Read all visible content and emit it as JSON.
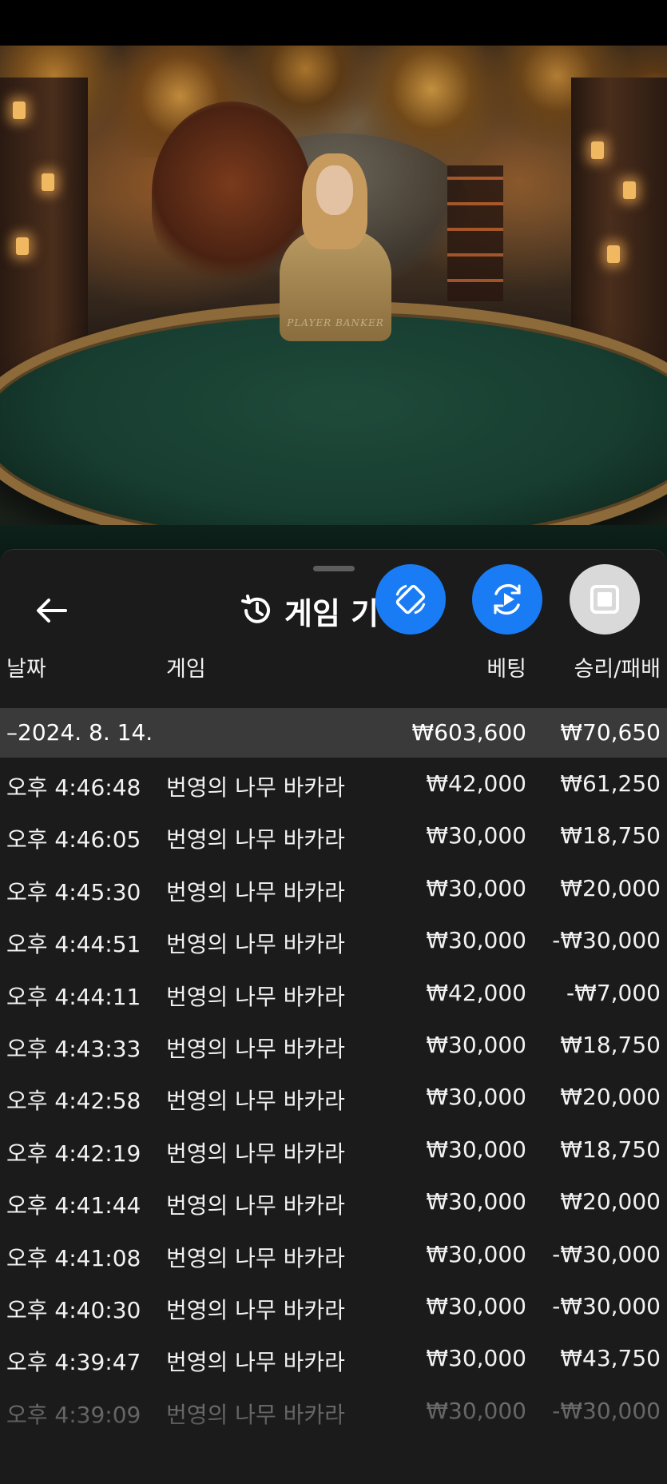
{
  "video": {
    "table_label": "PLAYER    BANKER"
  },
  "sheet": {
    "title": "게임 기",
    "icons": {
      "back": "arrow-left-icon",
      "history": "history-clock-icon",
      "rotate": "rotate-screen-icon",
      "replay": "replay-play-icon",
      "stop": "stop-square-icon"
    },
    "colors": {
      "sheet_bg": "#1b1b1b",
      "date_group_bg": "#3a3a3a",
      "fab_blue": "#1a7cf5",
      "fab_grey": "#d9d9d9"
    }
  },
  "table": {
    "headers": {
      "date": "날짜",
      "game": "게임",
      "bet": "베팅",
      "result": "승리/패배"
    },
    "group": {
      "date": "–2024. 8. 14.",
      "bet_total": "₩603,600",
      "result_total": "₩70,650"
    },
    "rows": [
      {
        "time": "오후 4:46:48",
        "game": "번영의 나무 바카라",
        "bet": "₩42,000",
        "result": "₩61,250"
      },
      {
        "time": "오후 4:46:05",
        "game": "번영의 나무 바카라",
        "bet": "₩30,000",
        "result": "₩18,750"
      },
      {
        "time": "오후 4:45:30",
        "game": "번영의 나무 바카라",
        "bet": "₩30,000",
        "result": "₩20,000"
      },
      {
        "time": "오후 4:44:51",
        "game": "번영의 나무 바카라",
        "bet": "₩30,000",
        "result": "-₩30,000"
      },
      {
        "time": "오후 4:44:11",
        "game": "번영의 나무 바카라",
        "bet": "₩42,000",
        "result": "-₩7,000"
      },
      {
        "time": "오후 4:43:33",
        "game": "번영의 나무 바카라",
        "bet": "₩30,000",
        "result": "₩18,750"
      },
      {
        "time": "오후 4:42:58",
        "game": "번영의 나무 바카라",
        "bet": "₩30,000",
        "result": "₩20,000"
      },
      {
        "time": "오후 4:42:19",
        "game": "번영의 나무 바카라",
        "bet": "₩30,000",
        "result": "₩18,750"
      },
      {
        "time": "오후 4:41:44",
        "game": "번영의 나무 바카라",
        "bet": "₩30,000",
        "result": "₩20,000"
      },
      {
        "time": "오후 4:41:08",
        "game": "번영의 나무 바카라",
        "bet": "₩30,000",
        "result": "-₩30,000"
      },
      {
        "time": "오후 4:40:30",
        "game": "번영의 나무 바카라",
        "bet": "₩30,000",
        "result": "-₩30,000"
      },
      {
        "time": "오후 4:39:47",
        "game": "번영의 나무 바카라",
        "bet": "₩30,000",
        "result": "₩43,750"
      },
      {
        "time": "오후 4:39:09",
        "game": "번영의 나무 바카라",
        "bet": "₩30,000",
        "result": "-₩30,000"
      }
    ]
  }
}
